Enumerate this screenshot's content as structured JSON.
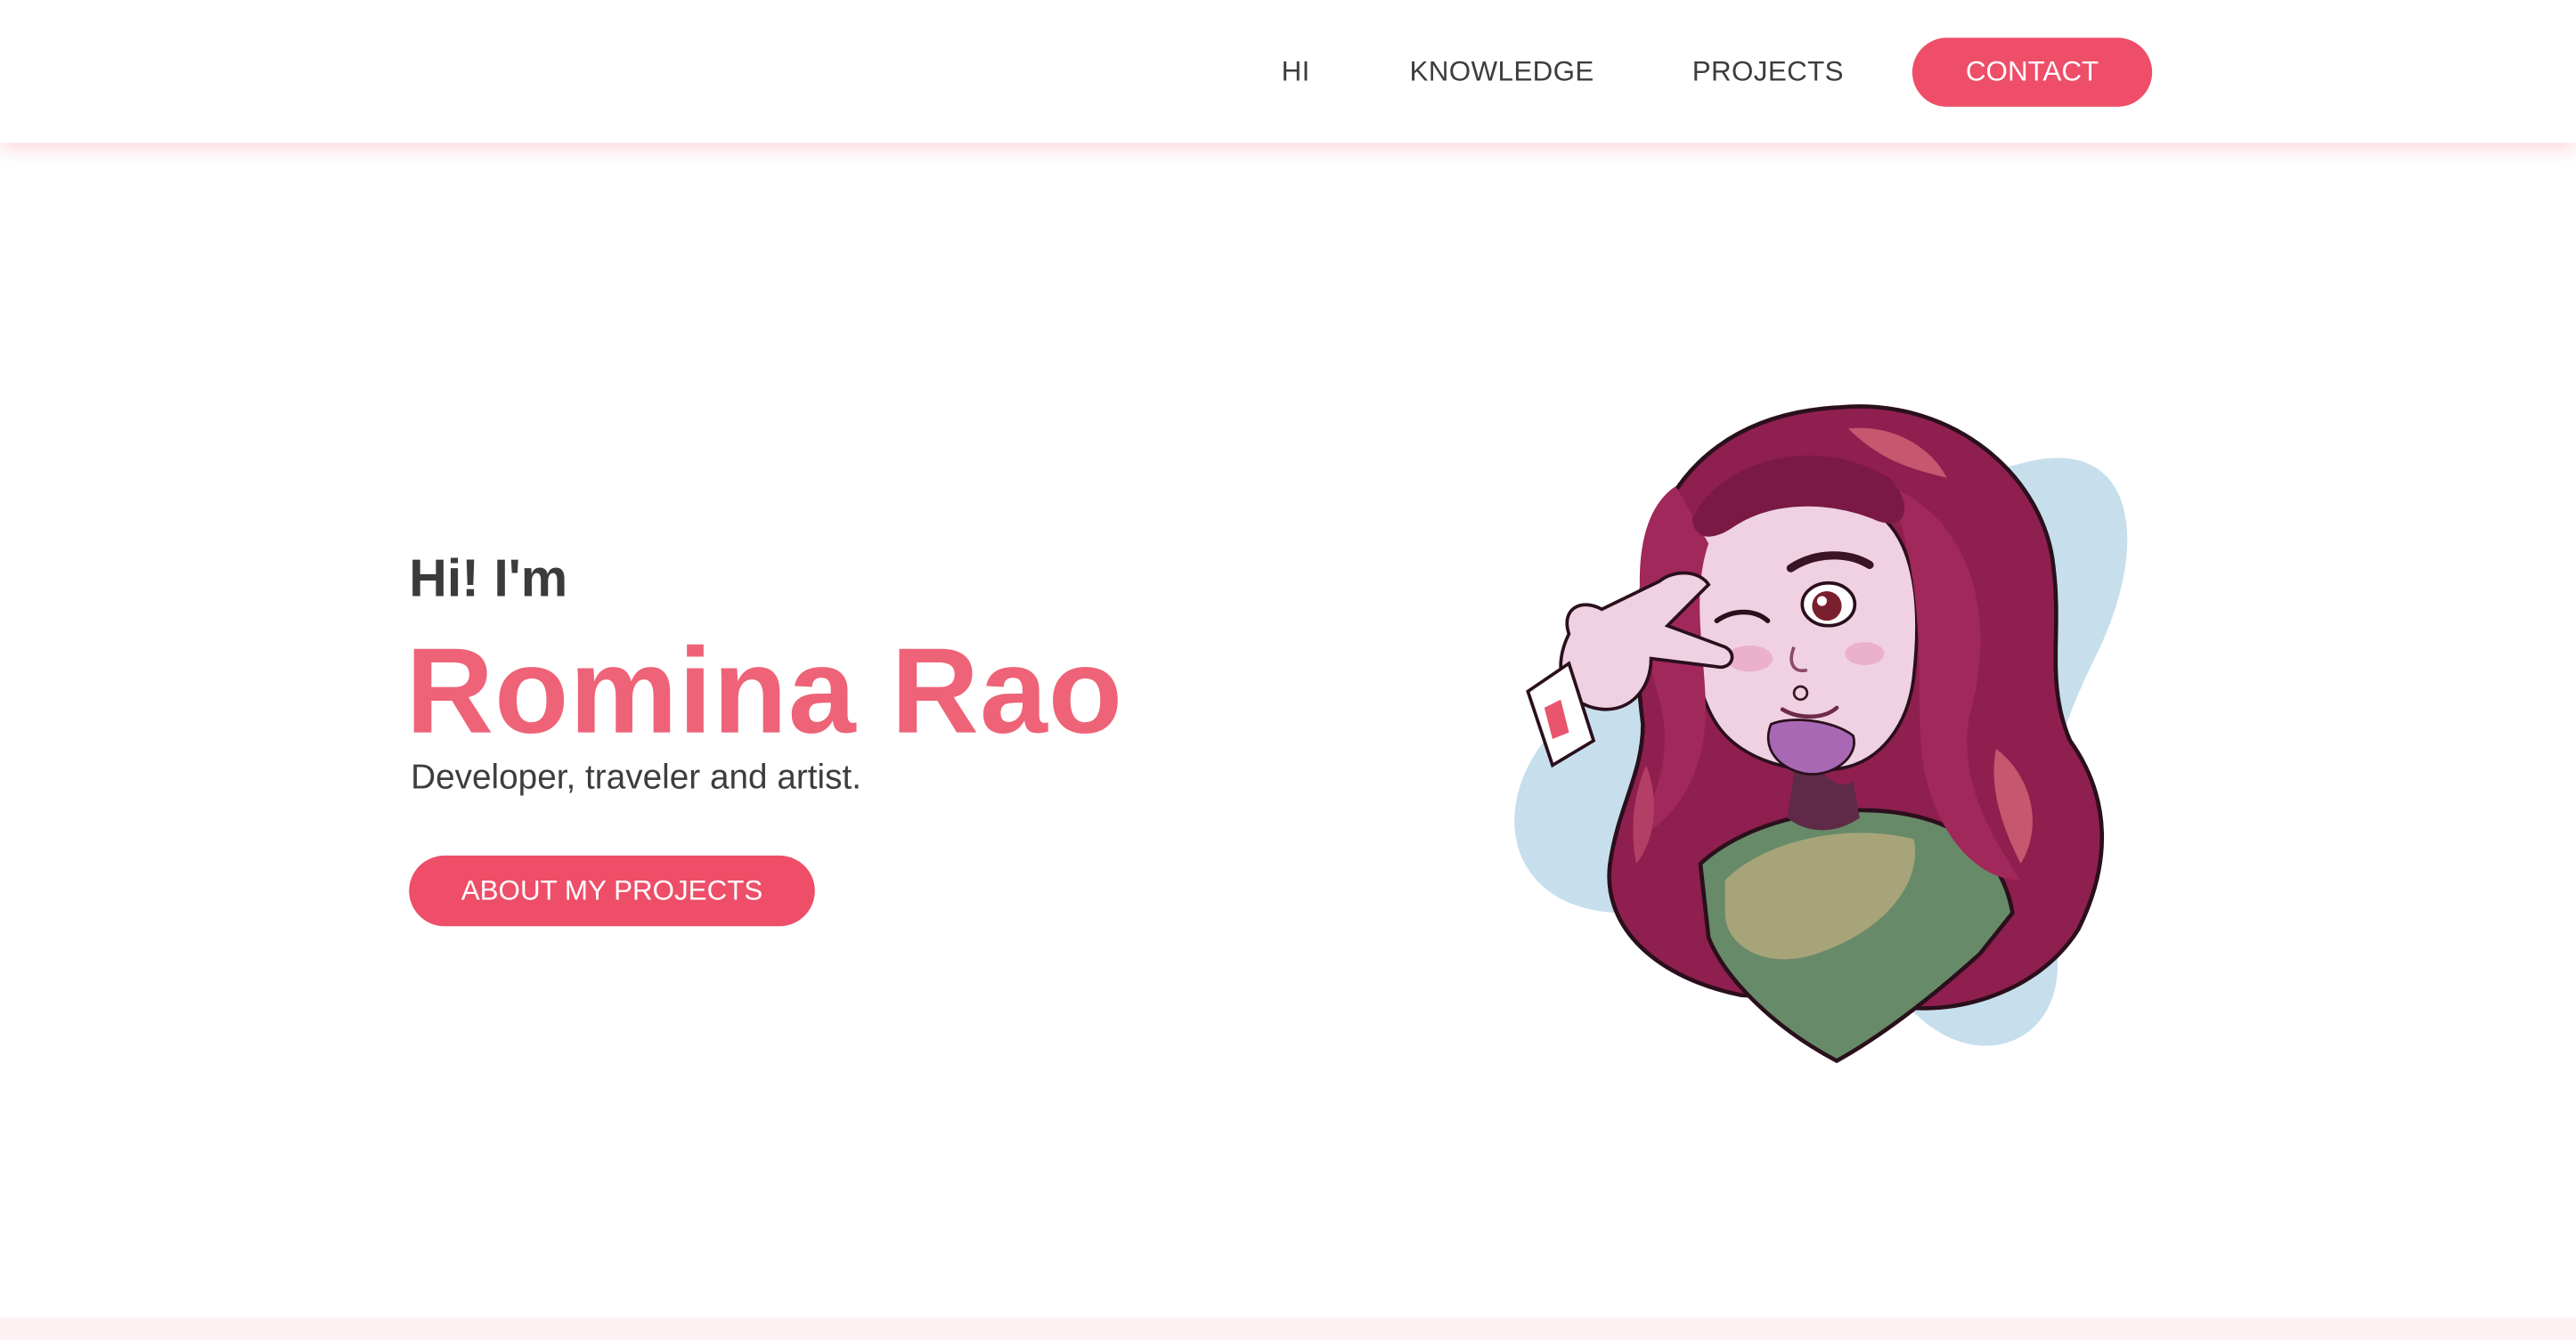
{
  "nav": {
    "items": [
      {
        "label": "HI"
      },
      {
        "label": "KNOWLEDGE"
      },
      {
        "label": "PROJECTS"
      }
    ],
    "contact_label": "CONTACT"
  },
  "hero": {
    "greeting": "Hi! I'm",
    "name": "Romina Rao",
    "tagline": "Developer, traveler and artist.",
    "button_label": "ABOUT MY PROJECTS",
    "avatar_image": "illustrated-avatar-winking-peace-sign"
  },
  "colors": {
    "accent": "#ee4e68",
    "name_text": "#ee6378",
    "dark_text": "#3b3b3b",
    "blob": "#c7dfec",
    "hair": "#8e1f4e",
    "shirt": "#678a69"
  }
}
